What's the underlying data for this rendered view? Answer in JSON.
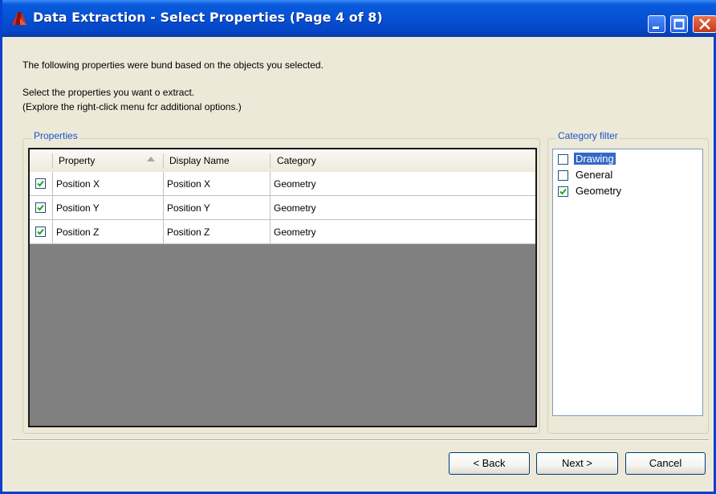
{
  "window": {
    "title": "Data Extraction - Select Properties (Page 4 of 8)"
  },
  "intro": {
    "line1": "The following properties were bund based on the objects you selected.",
    "line2": "Select the properties you want o extract.",
    "line3": "(Explore the right-click menu fcr additional options.)"
  },
  "properties": {
    "legend": "Properties",
    "columns": [
      "Property",
      "Display Name",
      "Category"
    ],
    "rows": [
      {
        "checked": true,
        "property": "Position X",
        "display_name": "Position X",
        "category": "Geometry"
      },
      {
        "checked": true,
        "property": "Position Y",
        "display_name": "Position Y",
        "category": "Geometry"
      },
      {
        "checked": true,
        "property": "Position Z",
        "display_name": "Position Z",
        "category": "Geometry"
      }
    ]
  },
  "category_filter": {
    "legend": "Category filter",
    "items": [
      {
        "label": "Drawing",
        "checked": false,
        "selected": true
      },
      {
        "label": "General",
        "checked": false,
        "selected": false
      },
      {
        "label": "Geometry",
        "checked": true,
        "selected": false
      }
    ]
  },
  "buttons": {
    "back": "< Back",
    "next": "Next >",
    "cancel": "Cancel"
  },
  "colors": {
    "titlebar": "#0650d4",
    "legend_text": "#1b54c8",
    "selection": "#316ac5",
    "checkmark": "#21a121"
  }
}
